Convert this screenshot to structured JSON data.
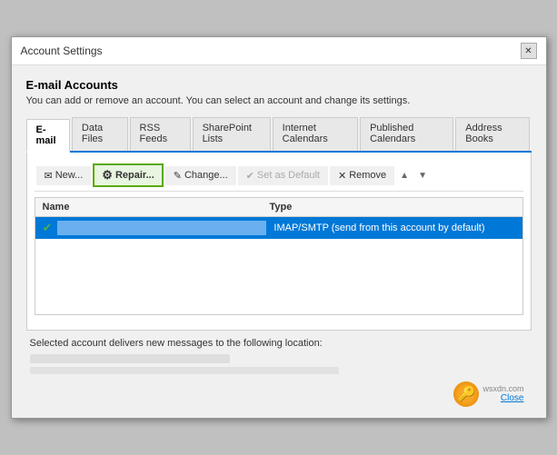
{
  "window": {
    "title": "Account Settings",
    "close_label": "✕"
  },
  "header": {
    "title": "E-mail Accounts",
    "description": "You can add or remove an account. You can select an account and change its settings."
  },
  "tabs": [
    {
      "label": "E-mail",
      "active": true
    },
    {
      "label": "Data Files",
      "active": false
    },
    {
      "label": "RSS Feeds",
      "active": false
    },
    {
      "label": "SharePoint Lists",
      "active": false
    },
    {
      "label": "Internet Calendars",
      "active": false
    },
    {
      "label": "Published Calendars",
      "active": false
    },
    {
      "label": "Address Books",
      "active": false
    }
  ],
  "toolbar": {
    "new_label": "New...",
    "repair_label": "Repair...",
    "change_label": "Change...",
    "set_default_label": "Set as Default",
    "remove_label": "Remove",
    "up_label": "▲",
    "down_label": "▼"
  },
  "table": {
    "col_name": "Name",
    "col_type": "Type",
    "rows": [
      {
        "icon": "✔",
        "name": "",
        "type": "IMAP/SMTP (send from this account by default)"
      }
    ]
  },
  "footer": {
    "label": "Selected account delivers new messages to the following location:",
    "line1": "",
    "line2": ""
  },
  "watermark": {
    "site": "wsxdn.com",
    "close_label": "Close"
  }
}
